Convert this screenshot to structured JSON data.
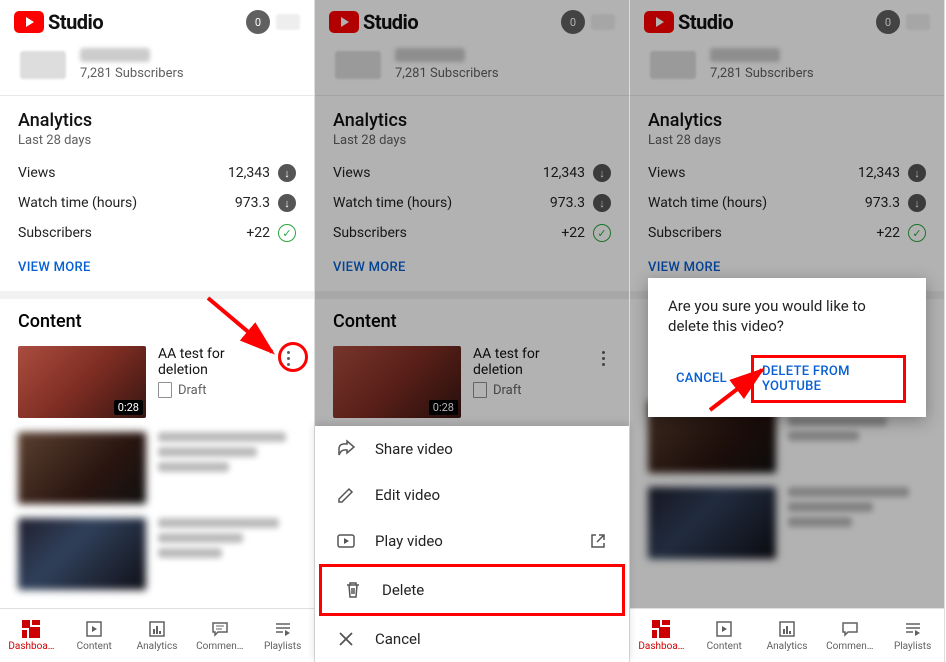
{
  "app": {
    "title": "Studio",
    "notification_count": "0"
  },
  "channel": {
    "subscribers": "7,281 Subscribers"
  },
  "analytics": {
    "title": "Analytics",
    "period": "Last 28 days",
    "rows": [
      {
        "label": "Views",
        "value": "12,343",
        "trend": "down"
      },
      {
        "label": "Watch time (hours)",
        "value": "973.3",
        "trend": "down"
      },
      {
        "label": "Subscribers",
        "value": "+22",
        "trend": "up"
      }
    ],
    "view_more": "VIEW MORE"
  },
  "content": {
    "title": "Content",
    "video": {
      "title": "AA test for deletion",
      "status": "Draft",
      "duration": "0:28"
    }
  },
  "nav": {
    "dashboard": "Dashboa…",
    "content": "Content",
    "analytics": "Analytics",
    "comments": "Commen…",
    "playlists": "Playlists"
  },
  "sheet": {
    "share": "Share video",
    "edit": "Edit video",
    "play": "Play video",
    "delete": "Delete",
    "cancel": "Cancel"
  },
  "dialog": {
    "message": "Are you sure you would like to delete this video?",
    "cancel": "CANCEL",
    "confirm": "DELETE FROM YOUTUBE"
  }
}
